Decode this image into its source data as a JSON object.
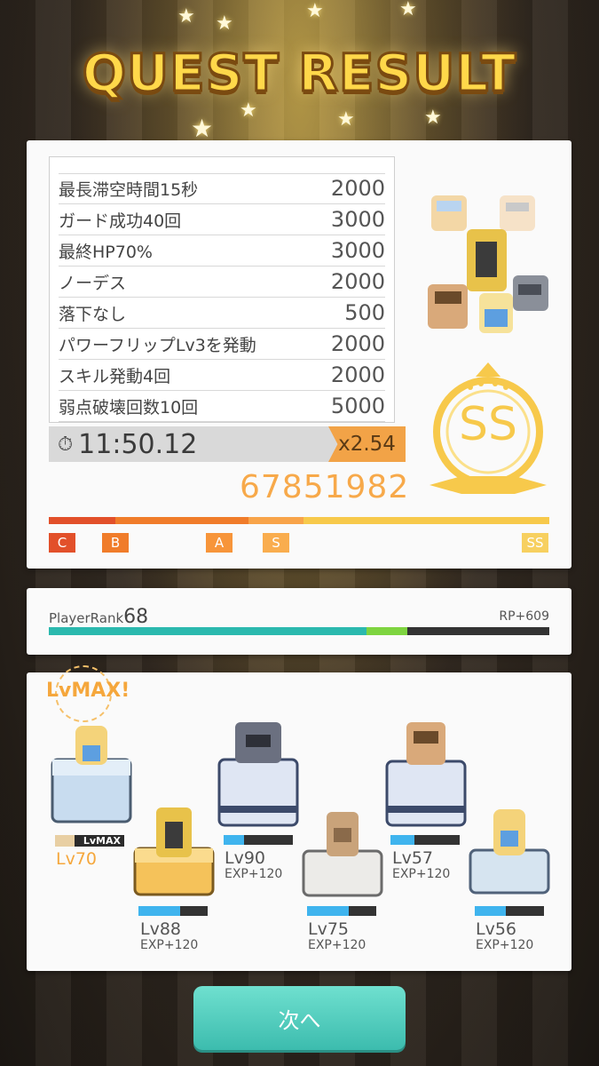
{
  "title": "QUEST RESULT",
  "bonuses": [
    {
      "label": "最長滞空時間15秒",
      "points": "2000"
    },
    {
      "label": "ガード成功40回",
      "points": "3000"
    },
    {
      "label": "最終HP70%",
      "points": "3000"
    },
    {
      "label": "ノーデス",
      "points": "2000"
    },
    {
      "label": "落下なし",
      "points": "500"
    },
    {
      "label": "パワーフリップLv3を発動",
      "points": "2000"
    },
    {
      "label": "スキル発動4回",
      "points": "2000"
    },
    {
      "label": "弱点破壊回数10回",
      "points": "5000"
    }
  ],
  "clear_time": "11:50.12",
  "multiplier": "x2.54",
  "score": "67851982",
  "grade": "SS",
  "rank_markers": [
    "C",
    "B",
    "A",
    "S",
    "SS"
  ],
  "player": {
    "rank_label": "PlayerRank",
    "rank": "68",
    "rp_gain": "RP+609",
    "progress": 0.635,
    "gain": 0.08
  },
  "lvmax_tag": "LvMAX!",
  "units": [
    {
      "level": "Lv70",
      "lvmax_label": "LvMAX"
    },
    {
      "level": "Lv88",
      "exp": "EXP+120",
      "fill": 0.6
    },
    {
      "level": "Lv90",
      "exp": "EXP+120",
      "fill": 0.3
    },
    {
      "level": "Lv75",
      "exp": "EXP+120",
      "fill": 0.6
    },
    {
      "level": "Lv57",
      "exp": "EXP+120",
      "fill": 0.35
    },
    {
      "level": "Lv56",
      "exp": "EXP+120",
      "fill": 0.45
    }
  ],
  "next_button": "次へ",
  "colors": {
    "accent": "#3cbcae",
    "score": "#f7a94a",
    "grade": "#f7c94b"
  }
}
